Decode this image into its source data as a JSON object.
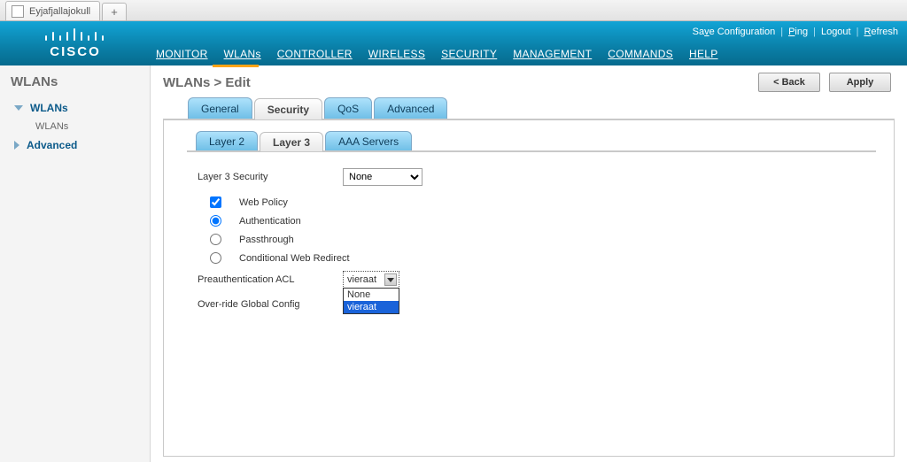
{
  "browser": {
    "tab_title": "Eyjafjallajokull",
    "newtab_glyph": "+"
  },
  "toplinks": {
    "save_config": "Save Configuration",
    "ping": "Ping",
    "logout": "Logout",
    "refresh": "Refresh"
  },
  "nav": {
    "monitor": "MONITOR",
    "wlans": "WLANs",
    "controller": "CONTROLLER",
    "wireless": "WIRELESS",
    "security": "SECURITY",
    "management": "MANAGEMENT",
    "commands": "COMMANDS",
    "help": "HELP"
  },
  "sidebar": {
    "title": "WLANs",
    "item1": "WLANs",
    "item1child": "WLANs",
    "item2": "Advanced"
  },
  "page": {
    "title": "WLANs > Edit",
    "back": "< Back",
    "apply": "Apply"
  },
  "tabs": {
    "general": "General",
    "security": "Security",
    "qos": "QoS",
    "advanced": "Advanced"
  },
  "subtabs": {
    "layer2": "Layer 2",
    "layer3": "Layer 3",
    "aaa": "AAA Servers"
  },
  "form": {
    "l3sec_label": "Layer 3 Security",
    "l3sec_value": "None",
    "webpolicy": "Web Policy",
    "auth": "Authentication",
    "passthrough": "Passthrough",
    "cwr": "Conditional Web Redirect",
    "preauth_label": "Preauthentication ACL",
    "preauth_selected": "vieraat",
    "preauth_opts": {
      "none": "None",
      "vieraat": "vieraat"
    },
    "override_label": "Over-ride Global Config"
  }
}
